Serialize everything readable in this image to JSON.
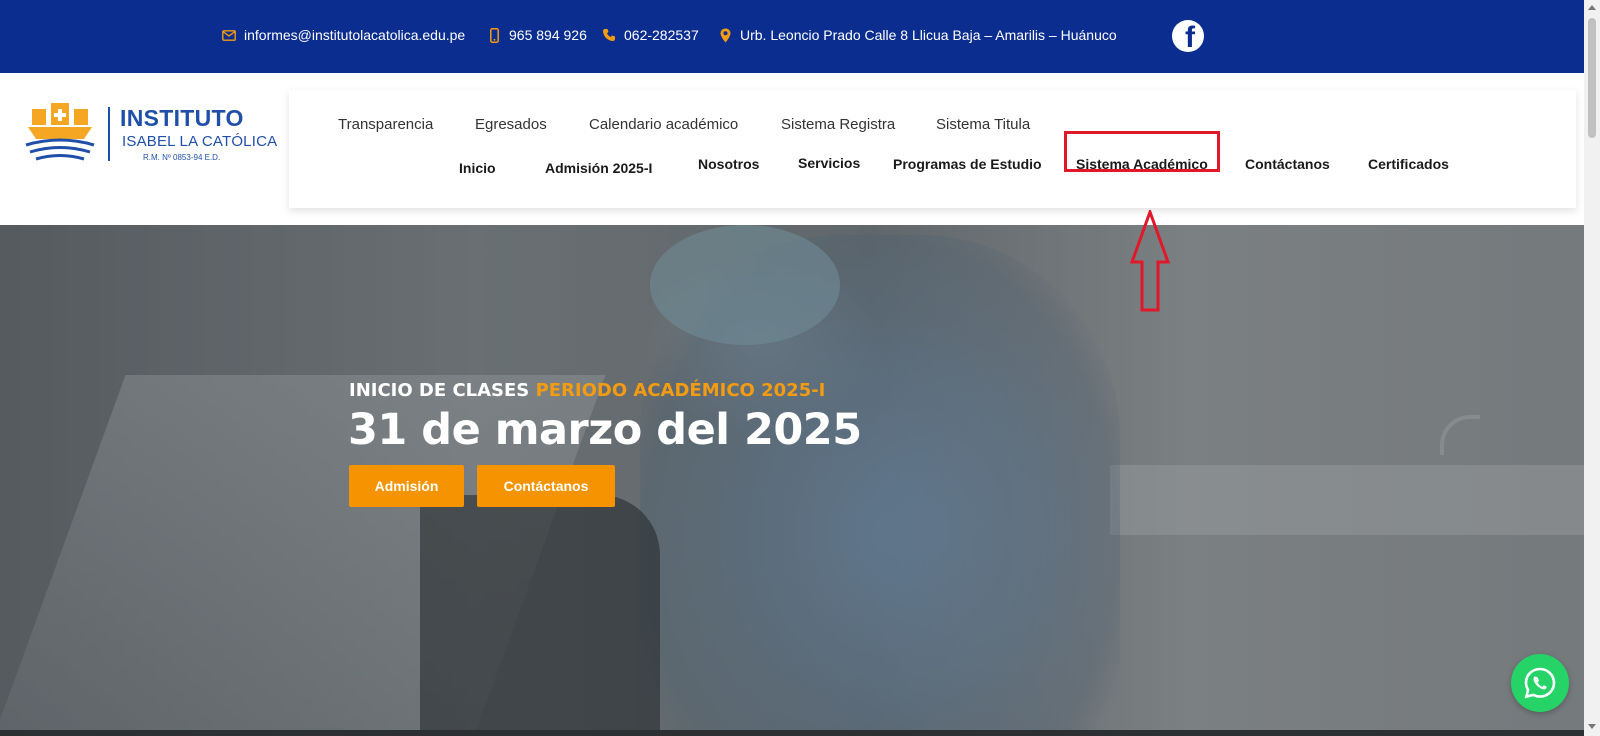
{
  "topbar": {
    "email": "informes@institutolacatolica.edu.pe",
    "mobile": "965 894 926",
    "phone": "062-282537",
    "address": "Urb. Leoncio Prado Calle 8 Llicua Baja – Amarilis – Huánuco"
  },
  "logo": {
    "line1": "INSTITUTO",
    "line2": "ISABEL LA CATÓLICA",
    "line3": "R.M. Nº 0853-94 E.D."
  },
  "nav_secondary": [
    "Transparencia",
    "Egresados",
    "Calendario académico",
    "Sistema Registra",
    "Sistema Titula"
  ],
  "nav_primary": [
    "Inicio",
    "Admisión 2025-I",
    "Nosotros",
    "Servicios",
    "Programas de Estudio",
    "Sistema Académico",
    "Contáctanos",
    "Certificados"
  ],
  "hero": {
    "tag_white": "INICIO DE CLASES",
    "tag_orange": "PERIODO ACADÉMICO 2025-I",
    "date": "31 de marzo del 2025",
    "btn_admision": "Admisión",
    "btn_contacto": "Contáctanos"
  },
  "colors": {
    "topbar_bg": "#0b2d8f",
    "accent_orange": "#f59300",
    "highlight_red": "#e0182a",
    "whatsapp_green": "#25d366"
  },
  "icons": [
    "envelope-icon",
    "mobile-icon",
    "phone-icon",
    "location-pin-icon",
    "facebook-icon",
    "whatsapp-icon"
  ]
}
